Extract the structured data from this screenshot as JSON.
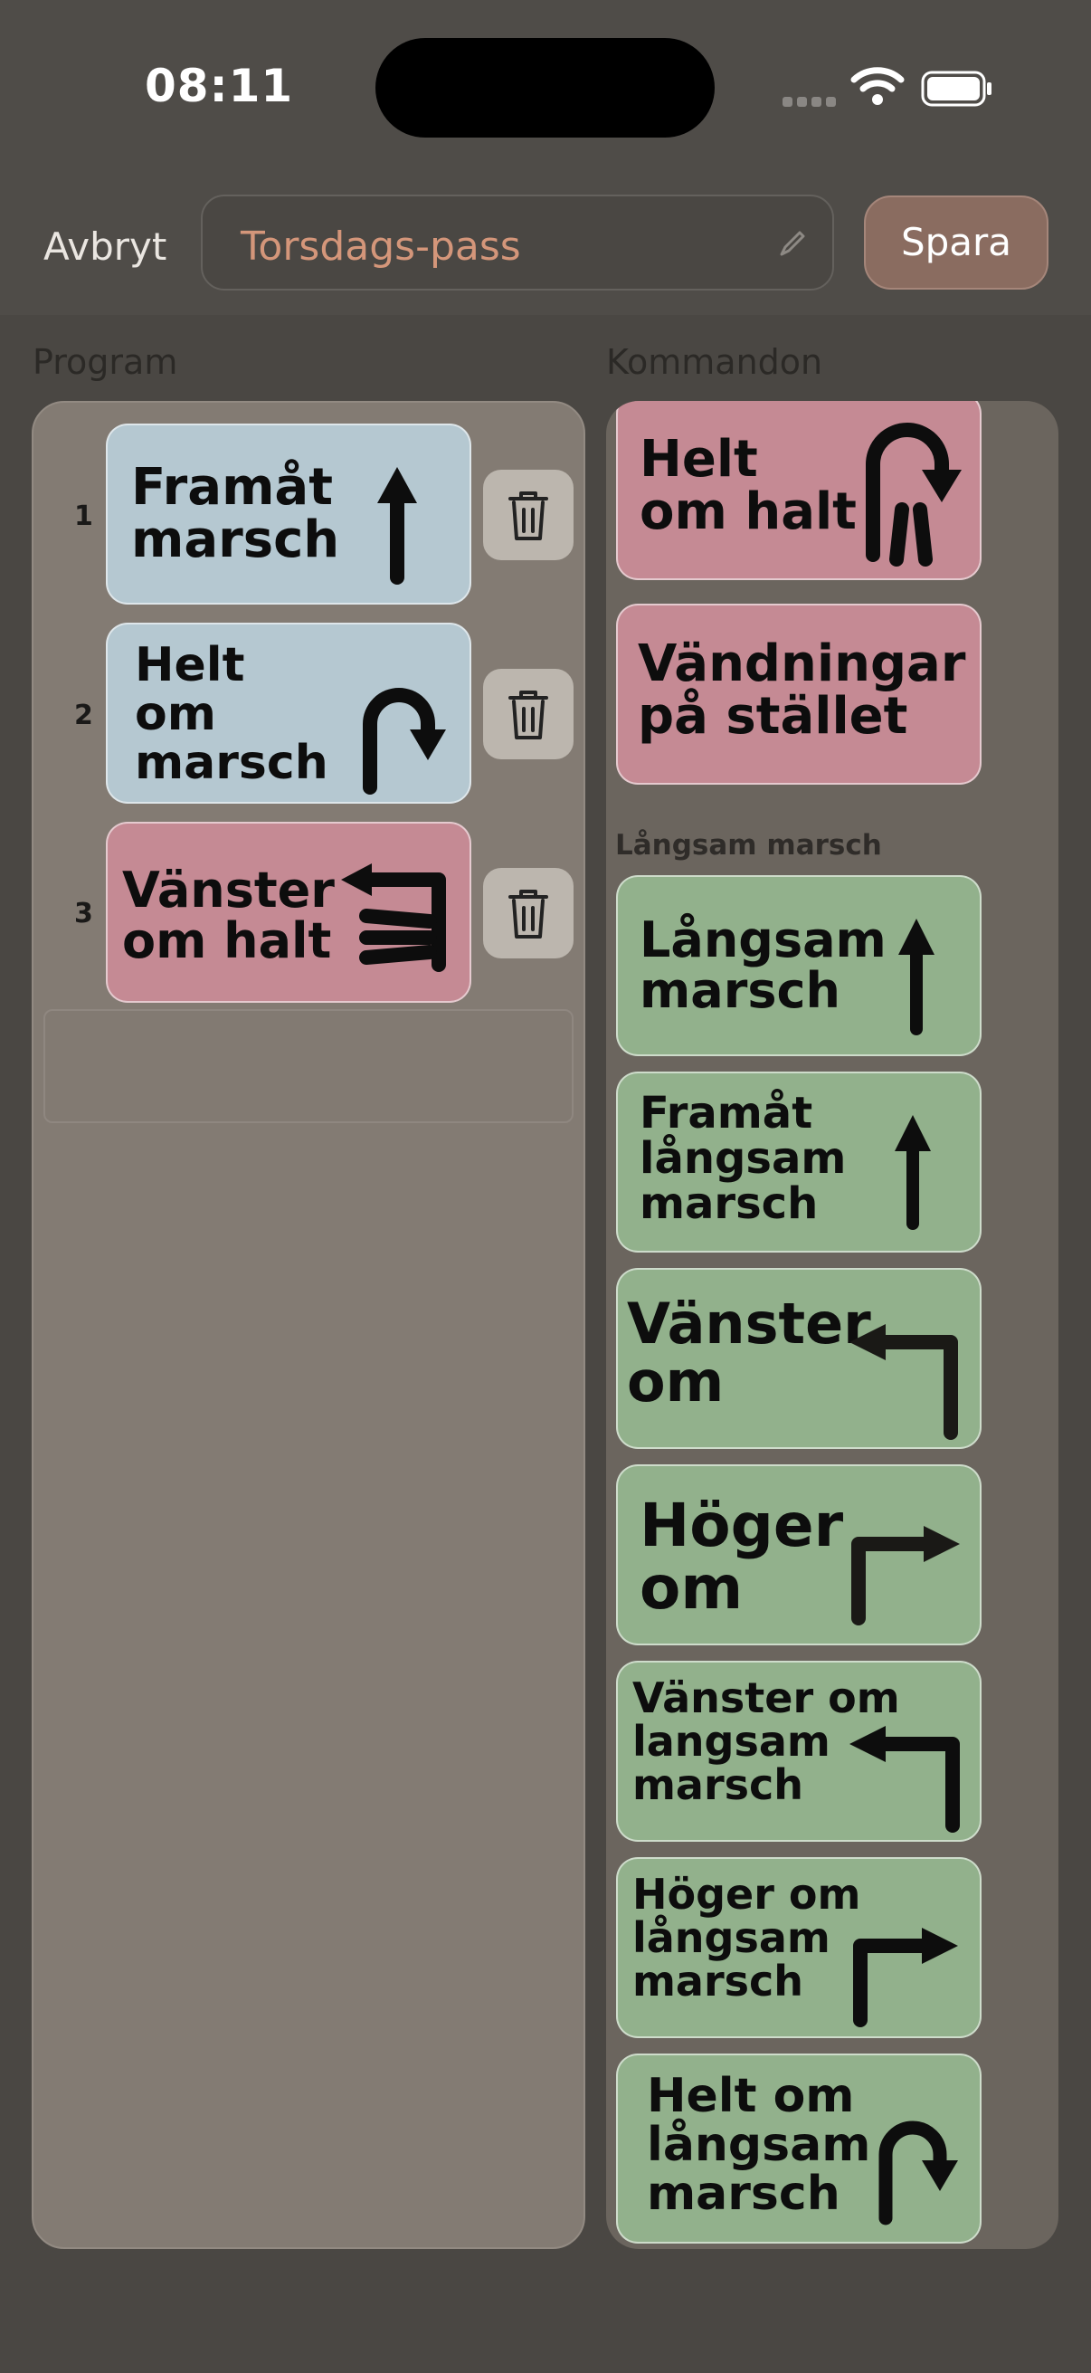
{
  "status": {
    "time": "08:11"
  },
  "toolbar": {
    "cancel_label": "Avbryt",
    "title_value": "Torsdags-pass",
    "save_label": "Spara"
  },
  "program": {
    "header": "Program",
    "items": [
      {
        "number": "1",
        "label": "Framåt\nmarsch",
        "color": "#b5c8d1",
        "icon": "arrow-up-icon"
      },
      {
        "number": "2",
        "label": "Helt\nom\nmarsch",
        "color": "#b5c8d1",
        "icon": "u-turn-icon"
      },
      {
        "number": "3",
        "label": "Vänster\nom halt",
        "color": "#c58a94",
        "icon": "left-halt-icon"
      }
    ]
  },
  "commands": {
    "header": "Kommandon",
    "group_label": "Långsam marsch",
    "items": [
      {
        "label": "Helt\nom halt",
        "color": "#c58a94",
        "icon": "u-turn-halt-icon"
      },
      {
        "label": "Vändningar\npå stället",
        "color": "#c58a94",
        "icon": ""
      },
      {
        "label": "Långsam\nmarsch",
        "color": "#92b18c",
        "icon": "arrow-up-icon"
      },
      {
        "label": "Framåt\nlångsam\nmarsch",
        "color": "#92b18c",
        "icon": "arrow-up-icon"
      },
      {
        "label": "Vänster\nom",
        "color": "#92b18c",
        "icon": "turn-left-icon"
      },
      {
        "label": "Höger\nom",
        "color": "#92b18c",
        "icon": "turn-right-icon"
      },
      {
        "label": "Vänster om\nlangsam\nmarsch",
        "color": "#92b18c",
        "icon": "turn-left-icon"
      },
      {
        "label": "Höger om\nlångsam\nmarsch",
        "color": "#92b18c",
        "icon": "turn-right-icon"
      },
      {
        "label": "Helt om\nlångsam\nmarsch",
        "color": "#92b18c",
        "icon": "u-turn-icon"
      }
    ]
  }
}
